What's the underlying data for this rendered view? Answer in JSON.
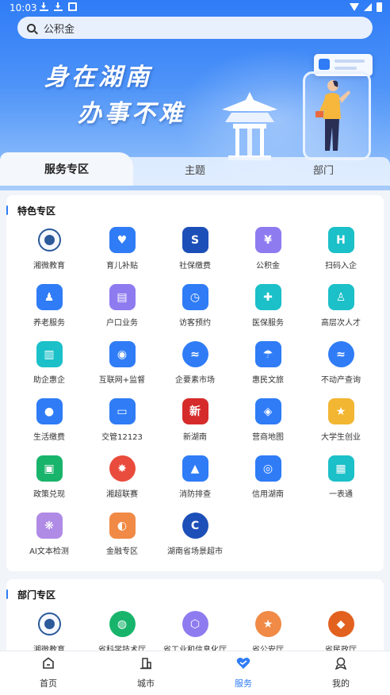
{
  "status_bar": {
    "time": "10:03"
  },
  "search": {
    "query": "公积金",
    "icon": "search-icon"
  },
  "banner": {
    "line1": "身在湖南",
    "line2": "办事不难"
  },
  "tabs": [
    {
      "label": "服务专区",
      "active": true
    },
    {
      "label": "主题",
      "active": false
    },
    {
      "label": "部门",
      "active": false
    }
  ],
  "featured": {
    "title": "特色专区",
    "items": [
      {
        "label": "湘微教育",
        "icon": "education-seal-icon",
        "color": "#2c5a9a"
      },
      {
        "label": "育儿补贴",
        "icon": "childcare-subsidy-icon",
        "color": "#2f7cf6"
      },
      {
        "label": "社保缴费",
        "icon": "social-security-icon",
        "color": "#1d4fb8"
      },
      {
        "label": "公积金",
        "icon": "housing-fund-icon",
        "color": "#8f7bf0"
      },
      {
        "label": "扫码入企",
        "icon": "scan-enterprise-icon",
        "color": "#1bc0c8"
      },
      {
        "label": "养老服务",
        "icon": "elderly-care-icon",
        "color": "#2f7cf6"
      },
      {
        "label": "户口业务",
        "icon": "household-registration-icon",
        "color": "#8f7bf0"
      },
      {
        "label": "访客预约",
        "icon": "visitor-appointment-icon",
        "color": "#2f7cf6"
      },
      {
        "label": "医保服务",
        "icon": "medical-insurance-icon",
        "color": "#1bc0c8"
      },
      {
        "label": "高层次人才",
        "icon": "talent-icon",
        "color": "#1bc0c8"
      },
      {
        "label": "助企惠企",
        "icon": "enterprise-support-icon",
        "color": "#1bc0c8"
      },
      {
        "label": "互联网+监督",
        "icon": "internet-supervision-icon",
        "color": "#2f7cf6"
      },
      {
        "label": "企要素市场",
        "icon": "factor-market-icon",
        "color": "#2f7cf6"
      },
      {
        "label": "惠民文旅",
        "icon": "culture-tourism-icon",
        "color": "#2f7cf6"
      },
      {
        "label": "不动产查询",
        "icon": "real-estate-icon",
        "color": "#2f7cf6"
      },
      {
        "label": "生活缴费",
        "icon": "utility-payment-icon",
        "color": "#2f7cf6"
      },
      {
        "label": "交管12123",
        "icon": "traffic-12123-icon",
        "color": "#2f7cf6"
      },
      {
        "label": "新湖南",
        "icon": "new-hunan-icon",
        "color": "#d62b2b"
      },
      {
        "label": "营商地图",
        "icon": "business-map-icon",
        "color": "#2f7cf6"
      },
      {
        "label": "大学生创业",
        "icon": "student-startup-icon",
        "color": "#f2b632"
      },
      {
        "label": "政策兑现",
        "icon": "policy-redemption-icon",
        "color": "#19b46b"
      },
      {
        "label": "湘超联赛",
        "icon": "xiang-super-league-icon",
        "color": "#e94b3c"
      },
      {
        "label": "消防排查",
        "icon": "fire-inspection-icon",
        "color": "#2f7cf6"
      },
      {
        "label": "信用湖南",
        "icon": "credit-hunan-icon",
        "color": "#2f7cf6"
      },
      {
        "label": "一表通",
        "icon": "one-form-icon",
        "color": "#1bc0c8"
      },
      {
        "label": "AI文本检测",
        "icon": "ai-text-detect-icon",
        "color": "#b08be6"
      },
      {
        "label": "金融专区",
        "icon": "finance-piggy-icon",
        "color": "#f08a46"
      },
      {
        "label": "湖南省场景超市",
        "icon": "scene-supermarket-icon",
        "color": "#1d4fb8"
      }
    ]
  },
  "departments": {
    "title": "部门专区",
    "items": [
      {
        "label": "湘微教育",
        "icon": "education-seal-icon",
        "color": "#2c5a9a"
      },
      {
        "label": "省科学技术厅",
        "icon": "science-dept-icon",
        "color": "#19b46b"
      },
      {
        "label": "省工业和信息化厅",
        "icon": "industry-it-dept-icon",
        "color": "#8f7bf0"
      },
      {
        "label": "省公安厅",
        "icon": "police-dept-icon",
        "color": "#f08a46"
      },
      {
        "label": "省民政厅",
        "icon": "civil-affairs-dept-icon",
        "color": "#e2611f"
      }
    ]
  },
  "bottom_nav": [
    {
      "label": "首页",
      "icon": "home-icon",
      "active": false
    },
    {
      "label": "城市",
      "icon": "city-icon",
      "active": false
    },
    {
      "label": "服务",
      "icon": "service-heart-icon",
      "active": true
    },
    {
      "label": "我的",
      "icon": "profile-icon",
      "active": false
    }
  ],
  "colors": {
    "accent": "#2f7cf6",
    "background": "#f1f4f9"
  }
}
